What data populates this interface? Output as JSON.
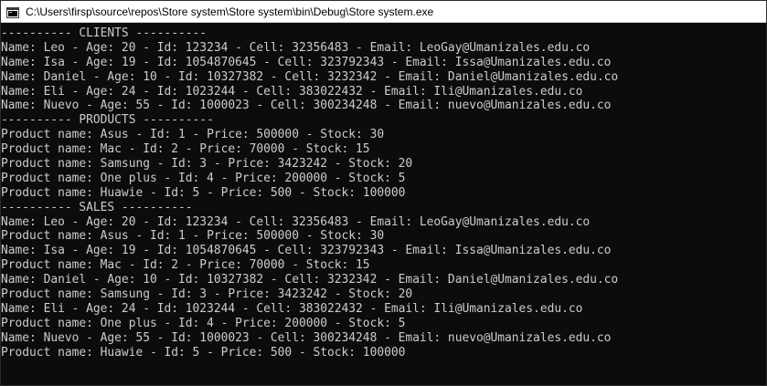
{
  "window": {
    "title": "C:\\Users\\firsp\\source\\repos\\Store system\\Store system\\bin\\Debug\\Store system.exe"
  },
  "console": {
    "lines": [
      "---------- CLIENTS ----------",
      "Name: Leo - Age: 20 - Id: 123234 - Cell: 32356483 - Email: LeoGay@Umanizales.edu.co",
      "Name: Isa - Age: 19 - Id: 1054870645 - Cell: 323792343 - Email: Issa@Umanizales.edu.co",
      "Name: Daniel - Age: 10 - Id: 10327382 - Cell: 3232342 - Email: Daniel@Umanizales.edu.co",
      "Name: Eli - Age: 24 - Id: 1023244 - Cell: 383022432 - Email: Ili@Umanizales.edu.co",
      "Name: Nuevo - Age: 55 - Id: 1000023 - Cell: 300234248 - Email: nuevo@Umanizales.edu.co",
      "---------- PRODUCTS ----------",
      "Product name: Asus - Id: 1 - Price: 500000 - Stock: 30",
      "Product name: Mac - Id: 2 - Price: 70000 - Stock: 15",
      "Product name: Samsung - Id: 3 - Price: 3423242 - Stock: 20",
      "Product name: One plus - Id: 4 - Price: 200000 - Stock: 5",
      "Product name: Huawie - Id: 5 - Price: 500 - Stock: 100000",
      "---------- SALES ----------",
      "Name: Leo - Age: 20 - Id: 123234 - Cell: 32356483 - Email: LeoGay@Umanizales.edu.co",
      "Product name: Asus - Id: 1 - Price: 500000 - Stock: 30",
      "Name: Isa - Age: 19 - Id: 1054870645 - Cell: 323792343 - Email: Issa@Umanizales.edu.co",
      "Product name: Mac - Id: 2 - Price: 70000 - Stock: 15",
      "Name: Daniel - Age: 10 - Id: 10327382 - Cell: 3232342 - Email: Daniel@Umanizales.edu.co",
      "Product name: Samsung - Id: 3 - Price: 3423242 - Stock: 20",
      "Name: Eli - Age: 24 - Id: 1023244 - Cell: 383022432 - Email: Ili@Umanizales.edu.co",
      "Product name: One plus - Id: 4 - Price: 200000 - Stock: 5",
      "Name: Nuevo - Age: 55 - Id: 1000023 - Cell: 300234248 - Email: nuevo@Umanizales.edu.co",
      "Product name: Huawie - Id: 5 - Price: 500 - Stock: 100000"
    ]
  },
  "icons": {
    "app_icon": "console-app-icon"
  },
  "colors": {
    "background": "#0c0c0c",
    "text": "#cccccc",
    "titlebar": "#ffffff"
  }
}
